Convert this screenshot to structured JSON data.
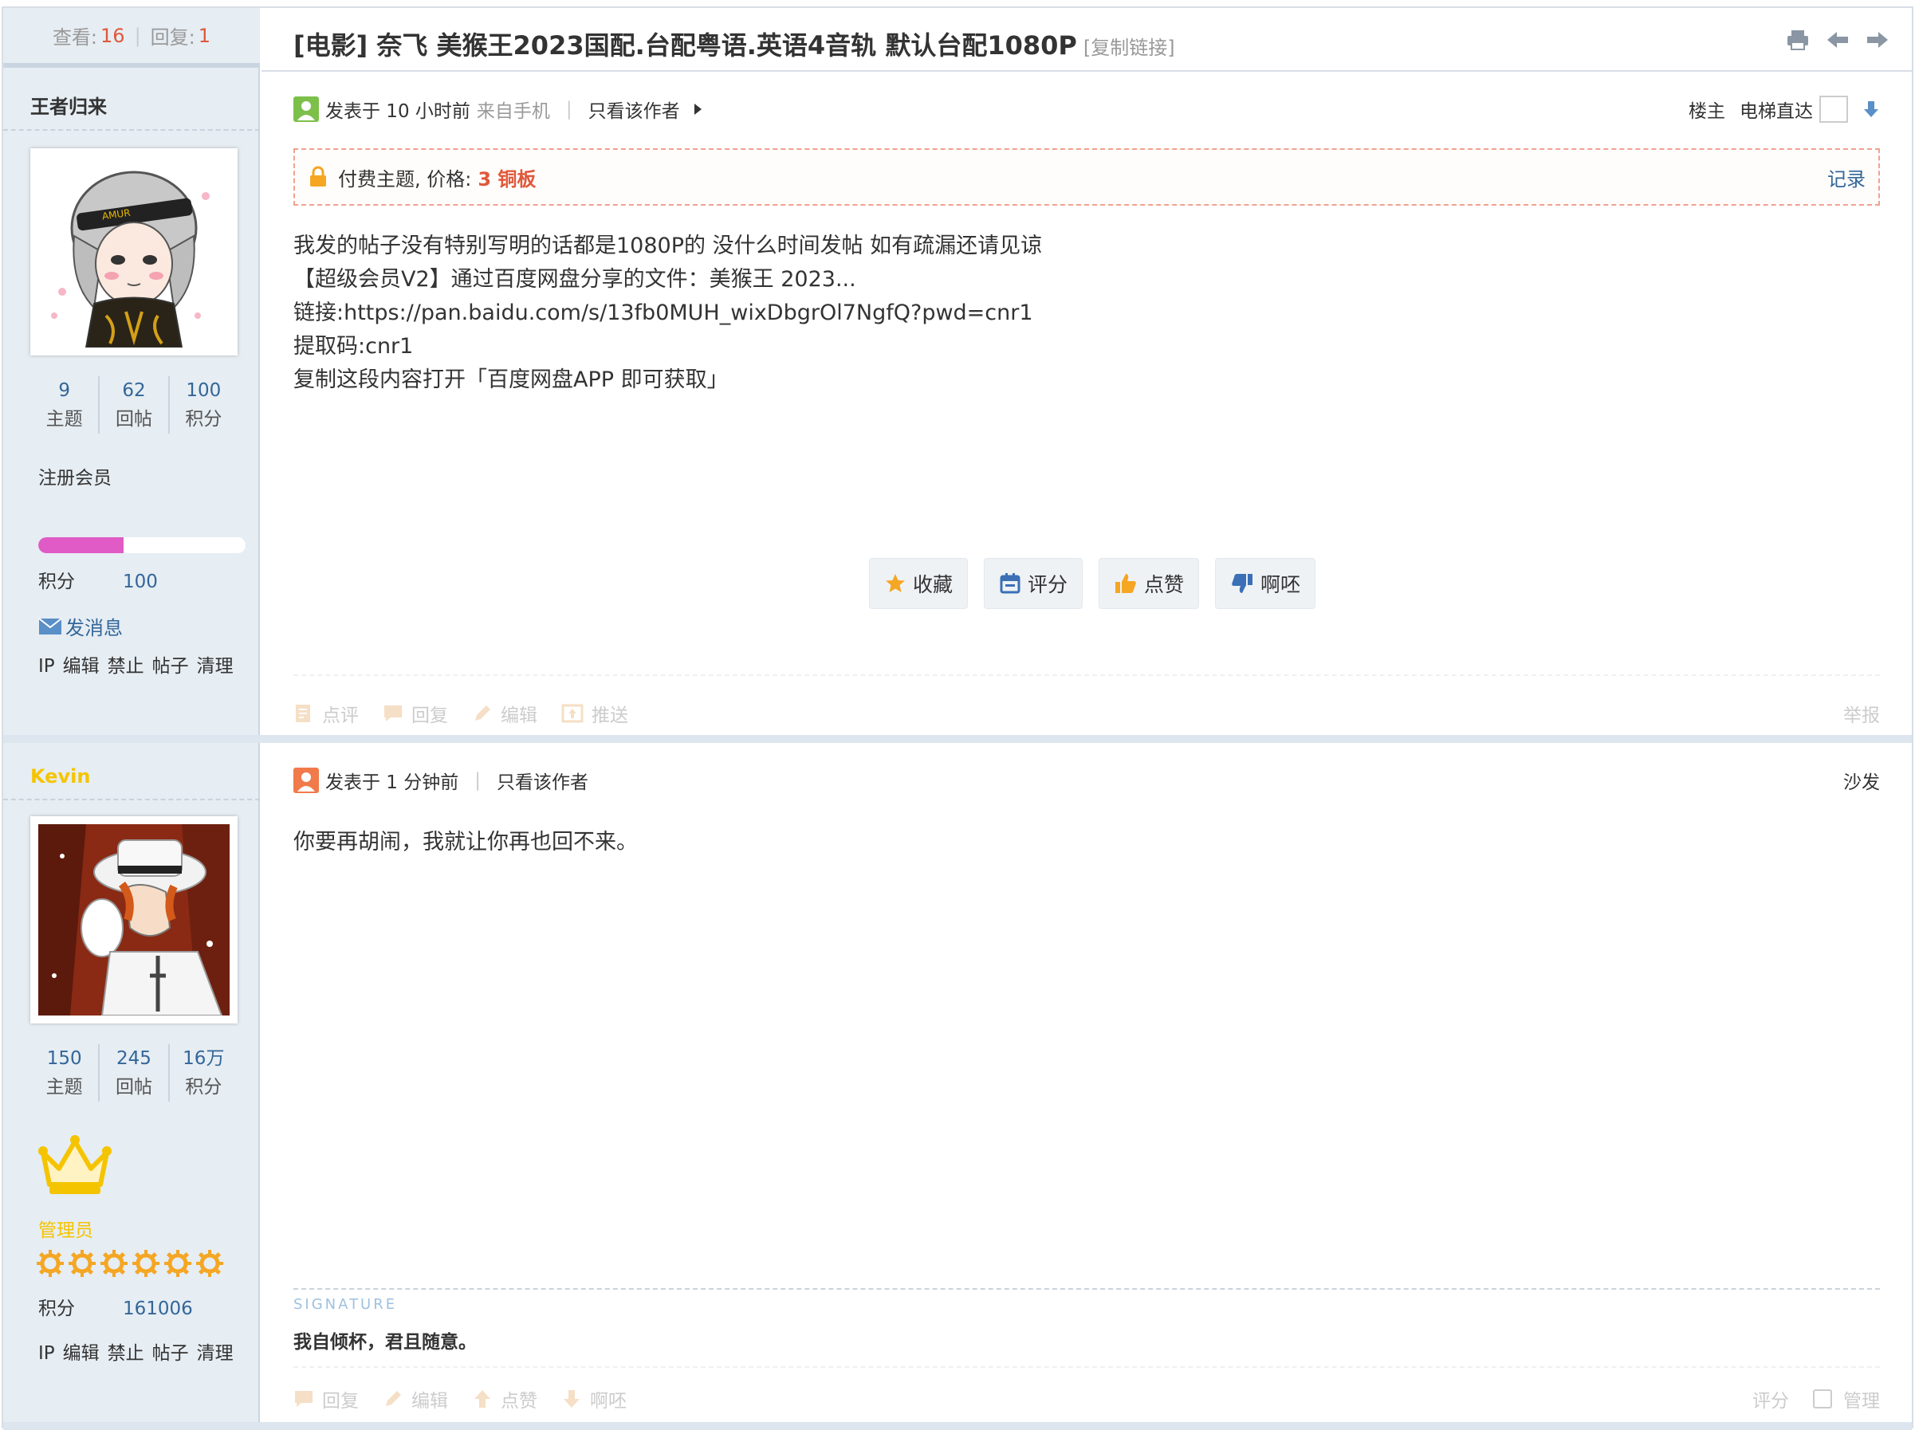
{
  "thread": {
    "views_label": "查看:",
    "views": "16",
    "replies_label": "回复:",
    "replies": "1",
    "title": "[电影] 奈飞 美猴王2023国配.台配粤语.英语4音轨 默认台配1080P",
    "copy_link": "[复制链接]"
  },
  "post1": {
    "author": "王者归来",
    "author_color": "#333333",
    "stats": [
      {
        "value": "9",
        "label": "主题"
      },
      {
        "value": "62",
        "label": "回帖"
      },
      {
        "value": "100",
        "label": "积分"
      }
    ],
    "rank": "注册会员",
    "level_progress": 0.41,
    "score_label": "积分",
    "score": "100",
    "send_msg": "发消息",
    "admin_links": [
      "IP",
      "编辑",
      "禁止",
      "帖子",
      "清理"
    ],
    "posted": "发表于 10 小时前",
    "from": "来自手机",
    "only_author": "只看该作者",
    "floor": "楼主",
    "elevator": "电梯直达",
    "paid_label": "付费主题, 价格:",
    "paid_price": "3 铜板",
    "record": "记录",
    "content": [
      "我发的帖子没有特别写明的话都是1080P的 没什么时间发帖 如有疏漏还请见谅",
      "【超级会员V2】通过百度网盘分享的文件：美猴王 2023...",
      "链接:https://pan.baidu.com/s/13fb0MUH_wixDbgrOl7NgfQ?pwd=cnr1",
      "提取码:cnr1",
      "复制这段内容打开「百度网盘APP 即可获取」"
    ],
    "actions": {
      "favorite": "收藏",
      "rate": "评分",
      "like": "点赞",
      "dislike": "啊呸"
    },
    "footer": {
      "comment": "点评",
      "reply": "回复",
      "edit": "编辑",
      "push": "推送",
      "report": "举报"
    }
  },
  "post2": {
    "author": "Kevin",
    "author_color": "#f5c400",
    "stats": [
      {
        "value": "150",
        "label": "主题"
      },
      {
        "value": "245",
        "label": "回帖"
      },
      {
        "value": "16万",
        "label": "积分"
      }
    ],
    "rank": "管理员",
    "rank_color": "#f5c400",
    "stars": 6,
    "score_label": "积分",
    "score": "161006",
    "admin_links": [
      "IP",
      "编辑",
      "禁止",
      "帖子",
      "清理"
    ],
    "posted": "发表于 1 分钟前",
    "only_author": "只看该作者",
    "floor": "沙发",
    "content": "你要再胡闹，我就让你再也回不来。",
    "signature_label": "SIGNATURE",
    "signature": "我自倾杯，君且随意。",
    "footer": {
      "reply": "回复",
      "edit": "编辑",
      "like": "点赞",
      "dislike": "啊呸",
      "rate": "评分",
      "manage": "管理"
    }
  },
  "colors": {
    "accent_link": "#336699",
    "highlight": "#e0583a",
    "left_bg": "#e6edf3"
  }
}
